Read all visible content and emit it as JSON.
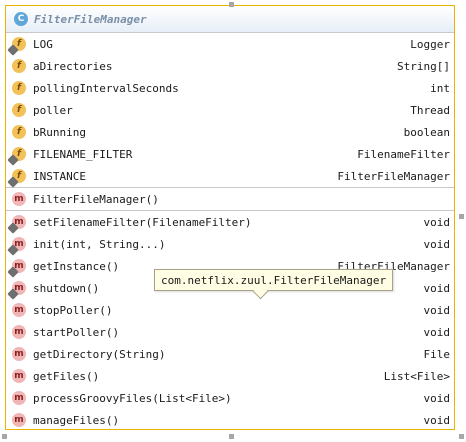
{
  "class": {
    "icon_letter": "C",
    "name": "FilterFileManager"
  },
  "fields": [
    {
      "icon": "f",
      "name": "LOG",
      "type": "Logger"
    },
    {
      "icon": "f",
      "name": "aDirectories",
      "type": "String[]"
    },
    {
      "icon": "f",
      "name": "pollingIntervalSeconds",
      "type": "int"
    },
    {
      "icon": "f",
      "name": "poller",
      "type": "Thread"
    },
    {
      "icon": "f",
      "name": "bRunning",
      "type": "boolean"
    },
    {
      "icon": "f",
      "name": "FILENAME_FILTER",
      "type": "FilenameFilter"
    },
    {
      "icon": "f",
      "name": "INSTANCE",
      "type": "FilterFileManager"
    }
  ],
  "constructors": [
    {
      "icon": "m",
      "name": "FilterFileManager()"
    }
  ],
  "methods": [
    {
      "icon": "m",
      "name": "setFilenameFilter(FilenameFilter)",
      "type": "void"
    },
    {
      "icon": "m",
      "name": "init(int, String...)",
      "type": "void"
    },
    {
      "icon": "m",
      "name": "getInstance()",
      "type": "FilterFileManager"
    },
    {
      "icon": "m",
      "name": "shutdown()",
      "type": "void"
    },
    {
      "icon": "m",
      "name": "stopPoller()",
      "type": "void"
    },
    {
      "icon": "m",
      "name": "startPoller()",
      "type": "void"
    },
    {
      "icon": "m",
      "name": "getDirectory(String)",
      "type": "File"
    },
    {
      "icon": "m",
      "name": "getFiles()",
      "type": "List<File>"
    },
    {
      "icon": "m",
      "name": "processGroovyFiles(List<File>)",
      "type": "void"
    },
    {
      "icon": "m",
      "name": "manageFiles()",
      "type": "void"
    }
  ],
  "tooltip": "com.netflix.zuul.FilterFileManager",
  "colors": {
    "selection_border": "#e8b400",
    "field_icon": "#f3c15a",
    "method_icon": "#f0b6b6",
    "class_icon": "#5fa6d9"
  }
}
